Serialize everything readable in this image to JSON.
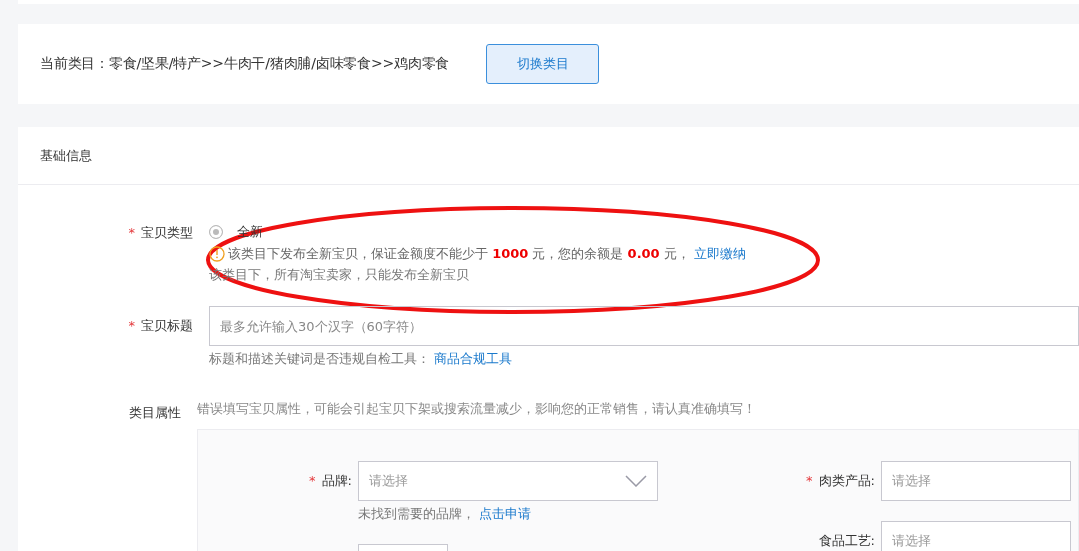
{
  "category_bar": {
    "current_category": "当前类目：零食/坚果/特产>>牛肉干/猪肉脯/卤味零食>>鸡肉零食",
    "switch_button": "切换类目"
  },
  "section": {
    "title": "基础信息"
  },
  "item_type": {
    "label": "宝贝类型",
    "required_mark": "*",
    "options": [
      {
        "label": "全新",
        "selected": true
      }
    ],
    "warning": {
      "parts": [
        "该类目下发布全新宝贝，保证金额度不能少于",
        "1000",
        "元，您的余额是",
        "0.00",
        "元，"
      ],
      "link": "立即缴纳"
    },
    "note": "该类目下，所有淘宝卖家，只能发布全新宝贝"
  },
  "item_title": {
    "label": "宝贝标题",
    "required_mark": "*",
    "placeholder": "最多允许输入30个汉字（60字符）",
    "hint": "标题和描述关键词是否违规自检工具：",
    "hint_link": "商品合规工具"
  },
  "attributes": {
    "label": "类目属性",
    "notice": "错误填写宝贝属性，可能会引起宝贝下架或搜索流量减少，影响您的正常销售，请认真准确填写！",
    "fields": [
      {
        "label": "品牌:",
        "required_mark": "*",
        "placeholder": "请选择",
        "dropdown": true,
        "hint": "未找到需要的品牌，",
        "hint_link": "点击申请"
      },
      {
        "label": "肉类产品:",
        "required_mark": "*",
        "placeholder": "请选择",
        "dropdown": false
      },
      {
        "label": "食品工艺:",
        "placeholder": "请选择",
        "dropdown": false
      }
    ]
  },
  "annotation": {
    "kind": "ellipse",
    "color": "#ee1111"
  }
}
